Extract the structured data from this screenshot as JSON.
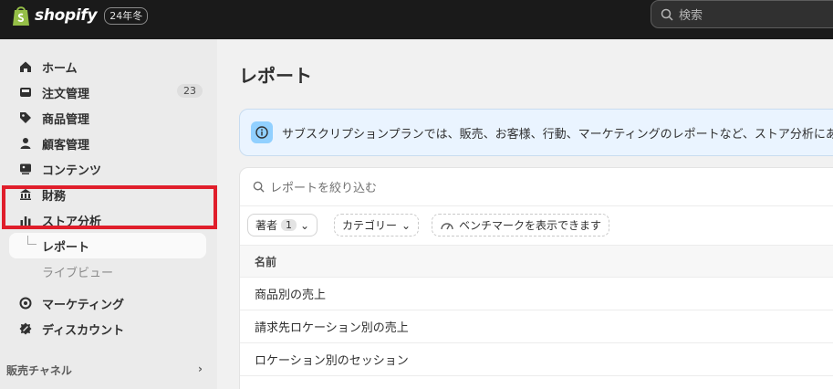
{
  "topbar": {
    "brand": "shopify",
    "edition": "24年冬",
    "search_placeholder": "検索"
  },
  "sidebar": {
    "items": [
      {
        "label": "ホーム",
        "icon": "home-icon"
      },
      {
        "label": "注文管理",
        "icon": "inbox-icon",
        "badge": "23"
      },
      {
        "label": "商品管理",
        "icon": "tag-icon"
      },
      {
        "label": "顧客管理",
        "icon": "person-icon"
      },
      {
        "label": "コンテンツ",
        "icon": "content-icon"
      },
      {
        "label": "財務",
        "icon": "bank-icon"
      },
      {
        "label": "ストア分析",
        "icon": "bar-chart-icon"
      }
    ],
    "subitems": [
      {
        "label": "レポート",
        "active": true
      },
      {
        "label": "ライブビュー"
      }
    ],
    "items2": [
      {
        "label": "マーケティング",
        "icon": "target-icon"
      },
      {
        "label": "ディスカウント",
        "icon": "discount-icon"
      }
    ],
    "sales_channels": "販売チャネル"
  },
  "main": {
    "title": "レポート",
    "banner": "サブスクリプションプランでは、販売、お客様、行動、マーケティングのレポートなど、ストア分析にあ",
    "filter_placeholder": "レポートを絞り込む",
    "chips": {
      "author": "著者",
      "author_count": "1",
      "category": "カテゴリー",
      "benchmark": "ベンチマークを表示できます"
    },
    "table": {
      "header": "名前",
      "rows": [
        "商品別の売上",
        "請求先ロケーション別の売上",
        "ロケーション別のセッション"
      ]
    }
  },
  "colors": {
    "topbar": "#1a1a1a",
    "highlight": "#e01e2b",
    "banner_bg": "#eaf4ff",
    "info_icon": "#91d0ff"
  }
}
